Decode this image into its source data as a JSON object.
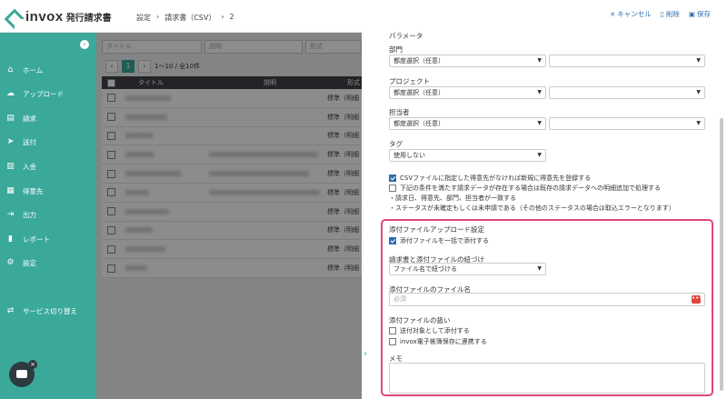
{
  "app": {
    "logo_text": "invox",
    "logo_sub": "発行請求書"
  },
  "breadcrumb": [
    "設定",
    "請求書（CSV）",
    "2"
  ],
  "sidebar": {
    "items": [
      {
        "label": "ホーム",
        "icon": "home-icon",
        "glyph": "⌂"
      },
      {
        "label": "アップロード",
        "icon": "cloud-upload-icon",
        "glyph": "☁"
      },
      {
        "label": "請求",
        "icon": "document-icon",
        "glyph": "▤"
      },
      {
        "label": "送付",
        "icon": "send-icon",
        "glyph": "➤"
      },
      {
        "label": "入金",
        "icon": "bank-icon",
        "glyph": "▥"
      },
      {
        "label": "得意先",
        "icon": "building-icon",
        "glyph": "▦"
      },
      {
        "label": "出力",
        "icon": "export-icon",
        "glyph": "⇥"
      },
      {
        "label": "レポート",
        "icon": "chart-icon",
        "glyph": "▮"
      },
      {
        "label": "設定",
        "icon": "gear-icon",
        "glyph": "⚙"
      }
    ],
    "switch_label": "サービス切り替え"
  },
  "list": {
    "filters": {
      "title": "タイトル",
      "desc": "説明",
      "format": "形式"
    },
    "pager": {
      "page": "1",
      "info": "1〜10 / 全10件"
    },
    "columns": [
      "タイトル",
      "説明",
      "形式"
    ],
    "rows": [
      "標準（明細",
      "標準（明細",
      "標準（明細",
      "標準（明細",
      "標準（明細",
      "標準（明細",
      "標準（明細",
      "標準（明細",
      "標準（明細",
      "標準（明細"
    ]
  },
  "panel": {
    "actions": {
      "cancel": "キャンセル",
      "delete": "削除",
      "save": "保存"
    },
    "params_label": "パラメータ",
    "dept": {
      "label": "部門",
      "value": "都度選択（任意）"
    },
    "project": {
      "label": "プロジェクト",
      "value": "都度選択（任意）"
    },
    "person": {
      "label": "担当者",
      "value": "都度選択（任意）"
    },
    "tag": {
      "label": "タグ",
      "value": "使用しない"
    },
    "opt1": "CSVファイルに指定した得意先がなければ新規に得意先を登録する",
    "opt2": "下記の条件を満たす請求データが存在する場合は既存の請求データへの明細追加で処理する",
    "cond1": "・請求日、得意先、部門、担当者が一致する",
    "cond2": "・ステータスが未確定もしくは未申請である（その他のステータスの場合は取込エラーとなります）",
    "attach": {
      "section_label": "添付ファイルアップロード設定",
      "bulk_label": "添付ファイルを一括で添付する",
      "link_label": "請求書と添付ファイルの紐づけ",
      "link_value": "ファイル名で紐づける",
      "filename_label": "添付ファイルのファイル名",
      "filename_placeholder": "必須",
      "handling_label": "添付ファイルの扱い",
      "send_label": "送付対象として添付する",
      "storage_label": "invox電子帳簿保存に連携する",
      "memo_label": "メモ"
    }
  },
  "colors": {
    "brand": "#3aa99a",
    "highlight": "#e0457b",
    "link": "#2e6fb0"
  }
}
